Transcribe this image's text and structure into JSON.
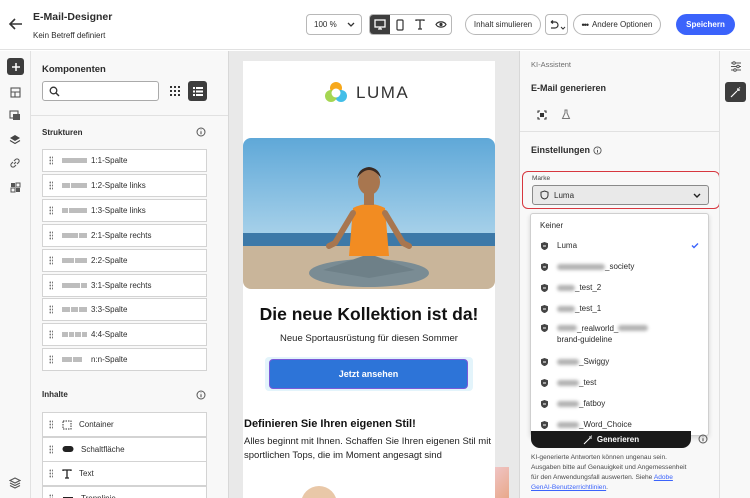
{
  "header": {
    "title": "E-Mail-Designer",
    "subtitle": "Kein Betreff definiert",
    "zoom": "100 %",
    "simulate": "Inhalt simulieren",
    "more": "Andere Optionen",
    "save": "Speichern"
  },
  "components": {
    "title": "Komponenten",
    "search_placeholder": "",
    "structures_title": "Strukturen",
    "structures": [
      {
        "label": "1:1-Spalte",
        "cols": [
          1
        ]
      },
      {
        "label": "1:2-Spalte links",
        "cols": [
          1,
          2
        ]
      },
      {
        "label": "1:3-Spalte links",
        "cols": [
          1,
          3
        ]
      },
      {
        "label": "2:1-Spalte rechts",
        "cols": [
          2,
          1
        ]
      },
      {
        "label": "2:2-Spalte",
        "cols": [
          1,
          1
        ]
      },
      {
        "label": "3:1-Spalte rechts",
        "cols": [
          3,
          1
        ]
      },
      {
        "label": "3:3-Spalte",
        "cols": [
          1,
          1,
          1
        ]
      },
      {
        "label": "4:4-Spalte",
        "cols": [
          1,
          1,
          1,
          1
        ]
      },
      {
        "label": "n:n-Spalte",
        "cols": [
          1,
          1,
          0
        ]
      }
    ],
    "contents_title": "Inhalte",
    "contents": [
      {
        "label": "Container",
        "icon": "container-icon"
      },
      {
        "label": "Schaltfläche",
        "icon": "button-icon"
      },
      {
        "label": "Text",
        "icon": "text-icon"
      },
      {
        "label": "Trennlinie",
        "icon": "divider-icon"
      }
    ]
  },
  "email": {
    "brand": "LUMA",
    "headline": "Die neue Kollektion ist da!",
    "subline": "Neue Sportausrüstung für diesen Sommer",
    "cta": "Jetzt ansehen",
    "section_title": "Definieren Sie Ihren eigenen Stil!",
    "body": "Alles beginnt mit Ihnen. Schaffen Sie Ihren eigenen Stil mit sportlichen Tops, die im Moment angesagt sind"
  },
  "ai": {
    "label": "KI-Assistent",
    "title": "E-Mail generieren",
    "settings": "Einstellungen",
    "brand_label": "Marke",
    "brand_value": "Luma",
    "options": [
      "Keiner",
      "Luma",
      "_society",
      "_test_2",
      "_test_1",
      "_realworld_",
      "brand-guideline",
      "_Swiggy",
      "_test",
      "_fatboy",
      "_Word_Choice"
    ],
    "generate": "Generieren",
    "disclaimer_1": "KI-generierte Antworten können ungenau sein.",
    "disclaimer_2": "Ausgaben bitte auf Genauigkeit und Angemessenheit",
    "disclaimer_3": "für den Anwendungsfall auswerten. Siehe",
    "disclaimer_link": "Adobe",
    "disclaimer_link2": "GenAI-Benutzerrichtlinien",
    "disclaimer_end": "."
  },
  "colors": {
    "accent": "#3b63fb",
    "highlight": "#d7373f",
    "cta": "#2d74d8"
  }
}
